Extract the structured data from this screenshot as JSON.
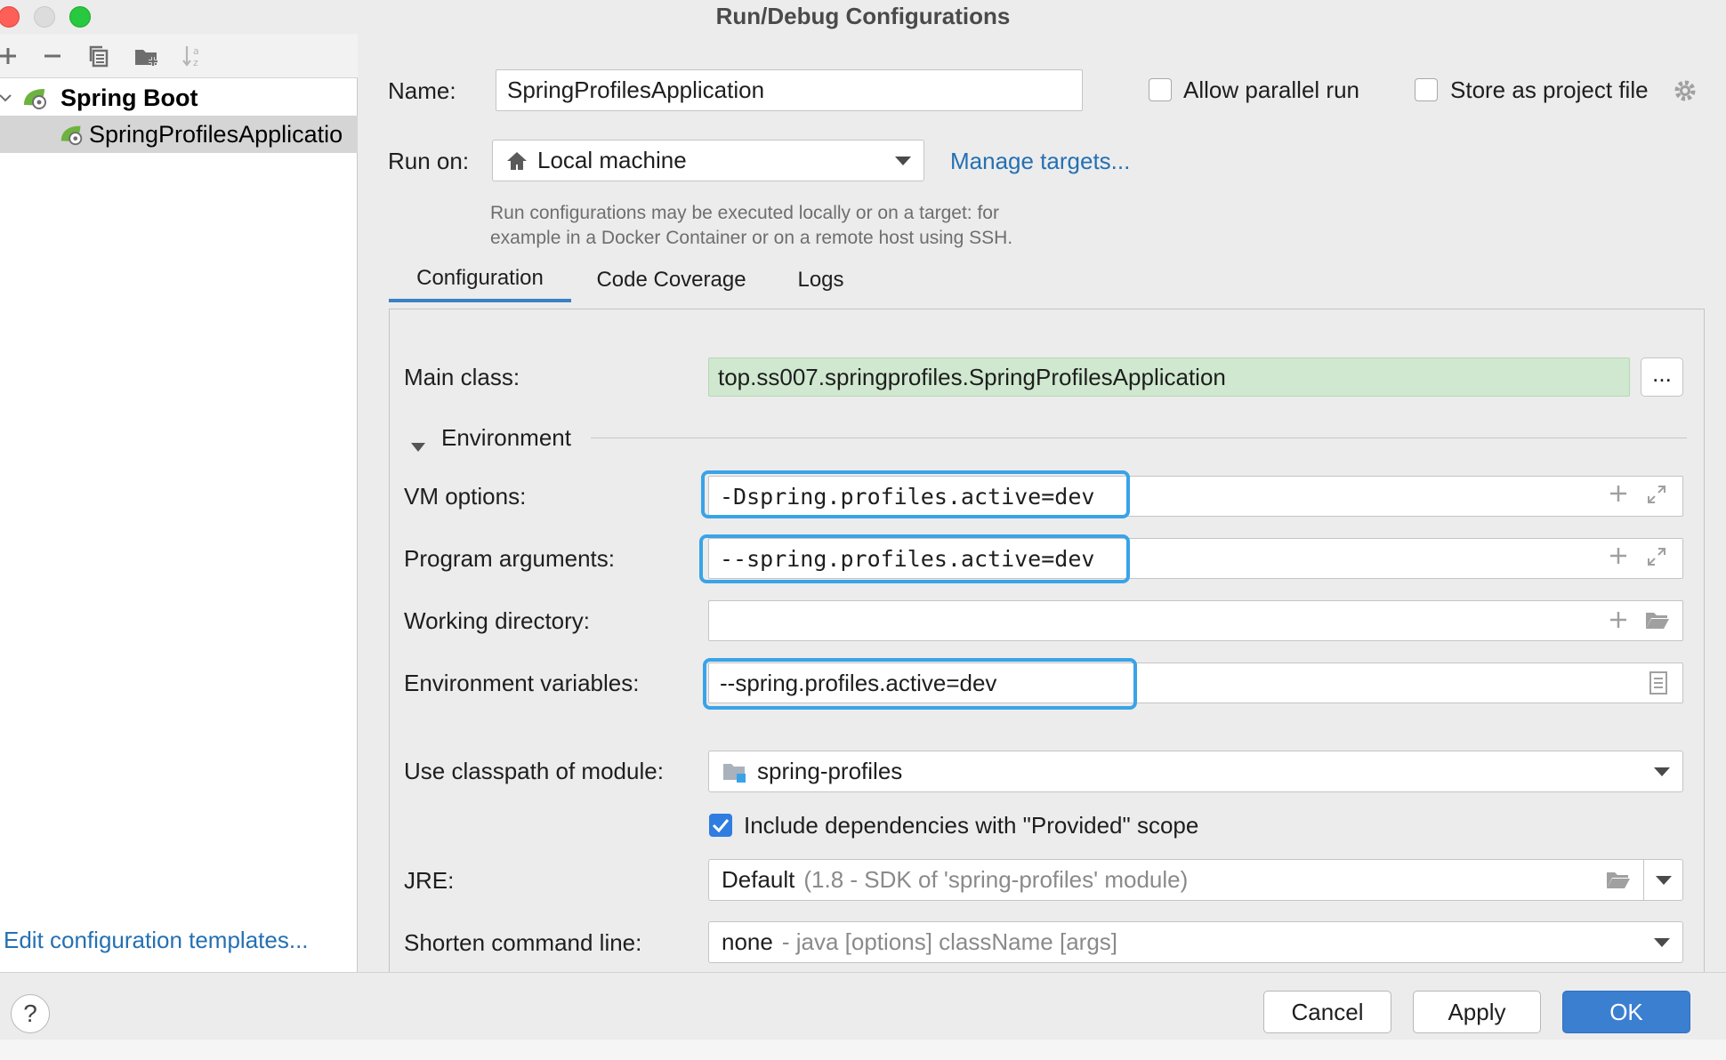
{
  "window": {
    "title": "Run/Debug Configurations"
  },
  "left_toolbar": {
    "icons": [
      "add-icon",
      "remove-icon",
      "copy-icon",
      "new-folder-icon",
      "sort-icon"
    ]
  },
  "tree": {
    "group_label": "Spring Boot",
    "item_label": "SpringProfilesApplicatio"
  },
  "edit_templates_label": "Edit configuration templates...",
  "name": {
    "label": "Name:",
    "value": "SpringProfilesApplication"
  },
  "allow_parallel_run": {
    "label": "Allow parallel run",
    "checked": false
  },
  "store_as_project_file": {
    "label": "Store as project file",
    "checked": false
  },
  "run_on": {
    "label": "Run on:",
    "value": "Local machine",
    "manage_link": "Manage targets..."
  },
  "hint": {
    "line1": "Run configurations may be executed locally or on a target: for",
    "line2": "example in a Docker Container or on a remote host using SSH."
  },
  "tabs": [
    {
      "label": "Configuration",
      "active": true
    },
    {
      "label": "Code Coverage",
      "active": false
    },
    {
      "label": "Logs",
      "active": false
    }
  ],
  "main_class": {
    "label": "Main class:",
    "value": "top.ss007.springprofiles.SpringProfilesApplication",
    "browse_label": "..."
  },
  "environment": {
    "label": "Environment"
  },
  "vm_options": {
    "label": "VM options:",
    "value": "-Dspring.profiles.active=dev"
  },
  "program_arguments": {
    "label": "Program arguments:",
    "value": "--spring.profiles.active=dev"
  },
  "working_directory": {
    "label": "Working directory:",
    "value": ""
  },
  "environment_variables": {
    "label": "Environment variables:",
    "value": "--spring.profiles.active=dev"
  },
  "classpath_module": {
    "label": "Use classpath of module:",
    "value": "spring-profiles"
  },
  "include_provided": {
    "label": "Include dependencies with \"Provided\" scope",
    "checked": true
  },
  "jre": {
    "label": "JRE:",
    "value": "Default",
    "hint": "(1.8 - SDK of 'spring-profiles' module)"
  },
  "shorten_command_line": {
    "label": "Shorten command line:",
    "value": "none",
    "hint": "- java [options] className [args]"
  },
  "buttons": {
    "help": "?",
    "cancel": "Cancel",
    "apply": "Apply",
    "ok": "OK"
  },
  "colors": {
    "accent": "#3b7fd1",
    "link": "#2470b3",
    "highlight": "#3aa3e8",
    "main_class_bg": "#cfe8cf"
  }
}
